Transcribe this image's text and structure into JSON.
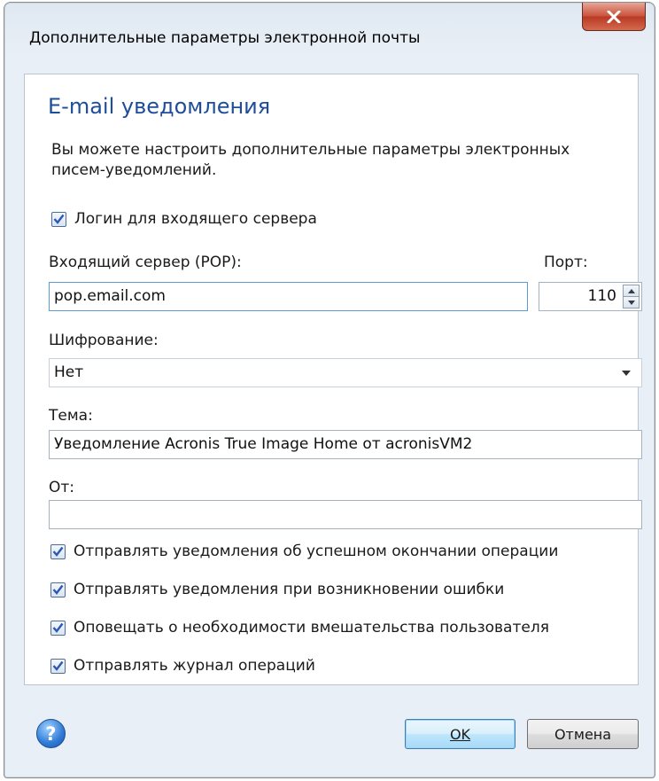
{
  "window": {
    "title": "Дополнительные параметры электронной почты"
  },
  "content": {
    "heading": "E-mail уведомления",
    "intro": "Вы можете настроить дополнительные параметры электронных писем-уведомлений.",
    "login_checkbox": {
      "label": "Логин для входящего сервера",
      "checked": true
    },
    "incoming_server": {
      "label": "Входящий сервер (POP):",
      "value": "pop.email.com"
    },
    "port": {
      "label": "Порт:",
      "value": "110"
    },
    "encryption": {
      "label": "Шифрование:",
      "value": "Нет"
    },
    "subject": {
      "label": "Тема:",
      "value": "Уведомление Acronis True Image Home от acronisVM2"
    },
    "from": {
      "label": "От:",
      "value": ""
    },
    "options": [
      {
        "label": "Отправлять уведомления об успешном окончании операции",
        "checked": true
      },
      {
        "label": "Отправлять уведомления при возникновении ошибки",
        "checked": true
      },
      {
        "label": "Оповещать о необходимости вмешательства пользователя",
        "checked": true
      },
      {
        "label": "Отправлять журнал операций",
        "checked": true
      }
    ]
  },
  "footer": {
    "help_glyph": "?",
    "ok_label": "OK",
    "cancel_label": "Отмена"
  },
  "colors": {
    "heading": "#1e4e9a",
    "checkmark": "#2b57b5",
    "focus_border": "#5f9bd3"
  }
}
